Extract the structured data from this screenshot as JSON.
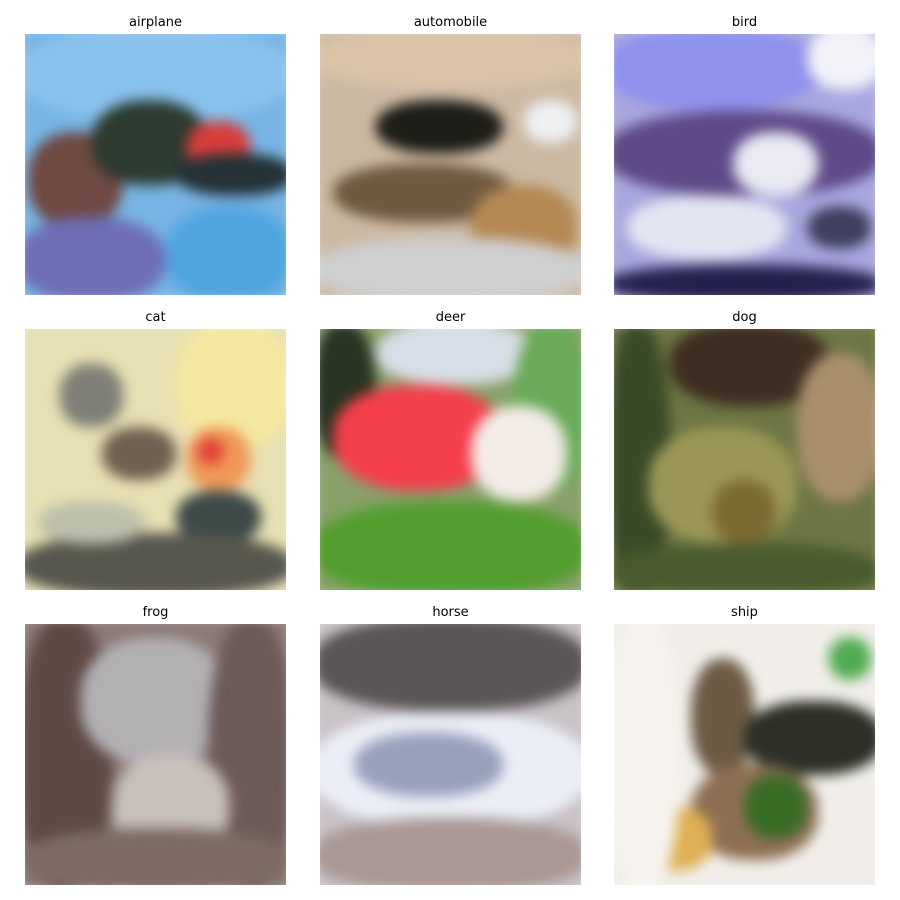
{
  "figure": {
    "panels": [
      {
        "title": "airplane"
      },
      {
        "title": "automobile"
      },
      {
        "title": "bird"
      },
      {
        "title": "cat"
      },
      {
        "title": "deer"
      },
      {
        "title": "dog"
      },
      {
        "title": "frog"
      },
      {
        "title": "horse"
      },
      {
        "title": "ship"
      }
    ]
  }
}
